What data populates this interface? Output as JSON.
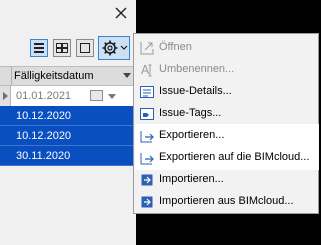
{
  "panel": {
    "close_glyph": "✕",
    "toolbar": {
      "view_buttons": [
        "list-view-icon",
        "grid-view-icon",
        "single-view-icon"
      ],
      "gear_icon": "gear-icon"
    },
    "table": {
      "column_header": "Fälligkeitsdatum",
      "rows": [
        {
          "date": "01.01.2021",
          "selected": false
        },
        {
          "date": "10.12.2020",
          "selected": true
        },
        {
          "date": "10.12.2020",
          "selected": true
        },
        {
          "date": "30.11.2020",
          "selected": true
        }
      ]
    }
  },
  "context_menu": {
    "items": [
      {
        "label": "Öffnen",
        "icon": "open-icon",
        "enabled": false
      },
      {
        "label": "Umbenennen...",
        "icon": "rename-icon",
        "enabled": false
      },
      {
        "label": "Issue-Details...",
        "icon": "issue-details-icon",
        "enabled": true
      },
      {
        "label": "Issue-Tags...",
        "icon": "issue-tags-icon",
        "enabled": true
      },
      {
        "label": "Exportieren...",
        "icon": "export-icon",
        "enabled": true,
        "highlighted": true
      },
      {
        "label": "Exportieren auf die BIMcloud...",
        "icon": "export-bimcloud-icon",
        "enabled": true,
        "highlighted": true
      },
      {
        "label": "Importieren...",
        "icon": "import-icon",
        "enabled": true
      },
      {
        "label": "Importieren aus BIMcloud...",
        "icon": "import-bimcloud-icon",
        "enabled": true
      }
    ]
  },
  "colors": {
    "selection": "#0a4fbf",
    "accent": "#3a84d6",
    "menu_bg": "#f2f2f2"
  }
}
